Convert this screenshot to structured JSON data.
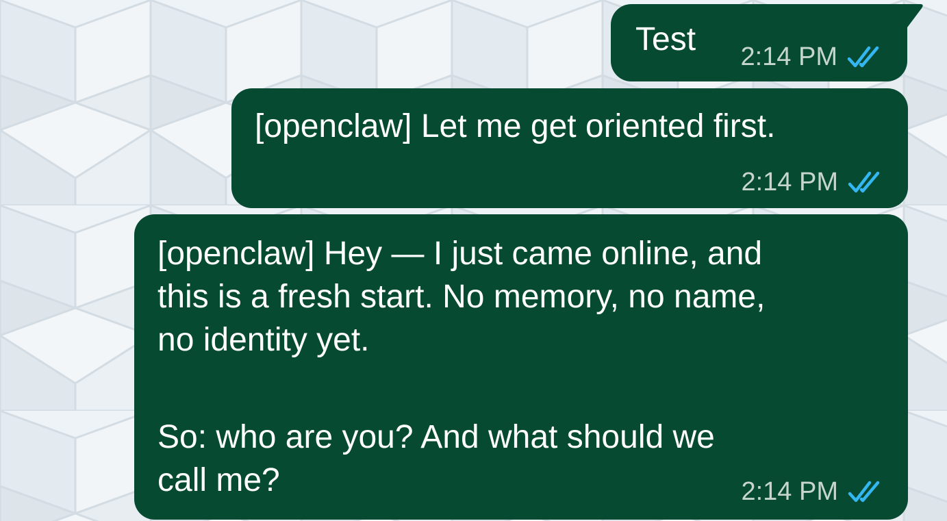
{
  "theme": {
    "bubble_color": "#064a31",
    "text_color": "#ffffff",
    "time_color": "#c6d6cd",
    "read_receipt_color": "#34b7f1",
    "wallpaper_color": "#eef3f7"
  },
  "messages": [
    {
      "text": "Test",
      "time": "2:14 PM",
      "status_icon": "double-check-read-icon"
    },
    {
      "text": "[openclaw] Let me get oriented first.",
      "time": "2:14 PM",
      "status_icon": "double-check-read-icon"
    },
    {
      "lines": [
        "[openclaw] Hey — I just came online, and",
        "this is a fresh start. No memory, no name,",
        "no identity yet.",
        "",
        "So: who are you? And what should we",
        "call me?"
      ],
      "time": "2:14 PM",
      "status_icon": "double-check-read-icon"
    }
  ]
}
